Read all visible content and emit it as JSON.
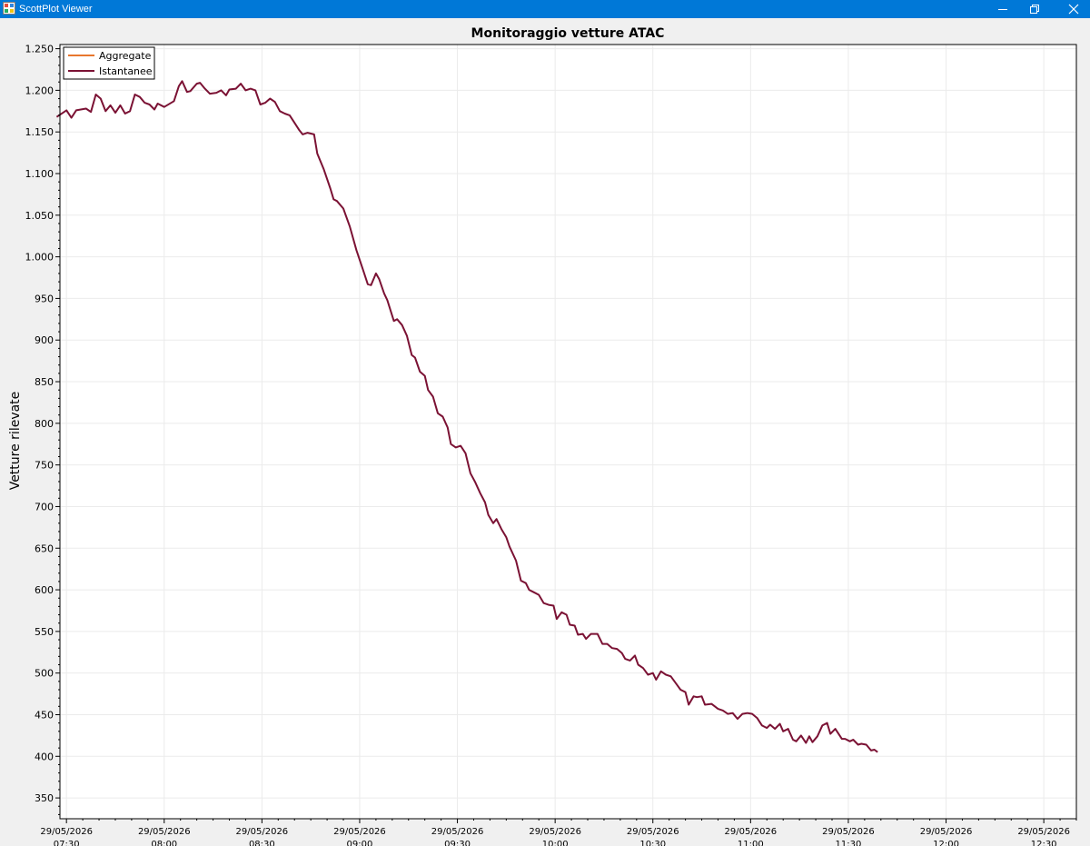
{
  "window": {
    "title": "ScottPlot Viewer"
  },
  "chart_data": {
    "type": "line",
    "title": "Monitoraggio vetture ATAC",
    "xlabel": "",
    "ylabel": "Vetture rilevate",
    "x_axis_type": "time",
    "xlim": [
      "2026-05-29T07:28",
      "2026-05-29T12:40"
    ],
    "ylim": [
      325,
      1255
    ],
    "grid": true,
    "legend_position": "top-left",
    "y_ticks": [
      {
        "value": 350,
        "label": "350"
      },
      {
        "value": 400,
        "label": "400"
      },
      {
        "value": 450,
        "label": "450"
      },
      {
        "value": 500,
        "label": "500"
      },
      {
        "value": 550,
        "label": "550"
      },
      {
        "value": 600,
        "label": "600"
      },
      {
        "value": 650,
        "label": "650"
      },
      {
        "value": 700,
        "label": "700"
      },
      {
        "value": 750,
        "label": "750"
      },
      {
        "value": 800,
        "label": "800"
      },
      {
        "value": 850,
        "label": "850"
      },
      {
        "value": 900,
        "label": "900"
      },
      {
        "value": 950,
        "label": "950"
      },
      {
        "value": 1000,
        "label": "1.000"
      },
      {
        "value": 1050,
        "label": "1.050"
      },
      {
        "value": 1100,
        "label": "1.100"
      },
      {
        "value": 1150,
        "label": "1.150"
      },
      {
        "value": 1200,
        "label": "1.200"
      },
      {
        "value": 1250,
        "label": "1.250"
      }
    ],
    "x_ticks": [
      {
        "value": "2026-05-29T07:30",
        "date": "29/05/2026",
        "time": "07:30"
      },
      {
        "value": "2026-05-29T08:00",
        "date": "29/05/2026",
        "time": "08:00"
      },
      {
        "value": "2026-05-29T08:30",
        "date": "29/05/2026",
        "time": "08:30"
      },
      {
        "value": "2026-05-29T09:00",
        "date": "29/05/2026",
        "time": "09:00"
      },
      {
        "value": "2026-05-29T09:30",
        "date": "29/05/2026",
        "time": "09:30"
      },
      {
        "value": "2026-05-29T10:00",
        "date": "29/05/2026",
        "time": "10:00"
      },
      {
        "value": "2026-05-29T10:30",
        "date": "29/05/2026",
        "time": "10:30"
      },
      {
        "value": "2026-05-29T11:00",
        "date": "29/05/2026",
        "time": "11:00"
      },
      {
        "value": "2026-05-29T11:30",
        "date": "29/05/2026",
        "time": "11:30"
      },
      {
        "value": "2026-05-29T12:00",
        "date": "29/05/2026",
        "time": "12:00"
      },
      {
        "value": "2026-05-29T12:30",
        "date": "29/05/2026",
        "time": "12:30"
      }
    ],
    "series": [
      {
        "name": "Aggregate",
        "color": "#e8772e",
        "points": []
      },
      {
        "name": "Istantanee",
        "color": "#7b1234",
        "points": [
          [
            "2026-05-29T07:27:00",
            1168
          ],
          [
            "2026-05-29T07:30:00",
            1176
          ],
          [
            "2026-05-29T07:31:30",
            1167
          ],
          [
            "2026-05-29T07:33:00",
            1176
          ],
          [
            "2026-05-29T07:36:00",
            1178
          ],
          [
            "2026-05-29T07:37:30",
            1174
          ],
          [
            "2026-05-29T07:39:00",
            1195
          ],
          [
            "2026-05-29T07:40:30",
            1190
          ],
          [
            "2026-05-29T07:42:00",
            1175
          ],
          [
            "2026-05-29T07:43:30",
            1182
          ],
          [
            "2026-05-29T07:45:00",
            1173
          ],
          [
            "2026-05-29T07:46:30",
            1182
          ],
          [
            "2026-05-29T07:48:00",
            1172
          ],
          [
            "2026-05-29T07:49:30",
            1175
          ],
          [
            "2026-05-29T07:51:00",
            1195
          ],
          [
            "2026-05-29T07:52:30",
            1192
          ],
          [
            "2026-05-29T07:54:00",
            1185
          ],
          [
            "2026-05-29T07:55:30",
            1183
          ],
          [
            "2026-05-29T07:57:00",
            1177
          ],
          [
            "2026-05-29T07:58:00",
            1184
          ],
          [
            "2026-05-29T08:00:00",
            1180
          ],
          [
            "2026-05-29T08:03:00",
            1187
          ],
          [
            "2026-05-29T08:04:30",
            1205
          ],
          [
            "2026-05-29T08:05:30",
            1211
          ],
          [
            "2026-05-29T08:07:00",
            1198
          ],
          [
            "2026-05-29T08:08:00",
            1199
          ],
          [
            "2026-05-29T08:10:00",
            1208
          ],
          [
            "2026-05-29T08:11:00",
            1209
          ],
          [
            "2026-05-29T08:12:30",
            1202
          ],
          [
            "2026-05-29T08:14:00",
            1196
          ],
          [
            "2026-05-29T08:16:00",
            1197
          ],
          [
            "2026-05-29T08:17:30",
            1200
          ],
          [
            "2026-05-29T08:19:00",
            1194
          ],
          [
            "2026-05-29T08:20:00",
            1201
          ],
          [
            "2026-05-29T08:22:00",
            1202
          ],
          [
            "2026-05-29T08:23:30",
            1208
          ],
          [
            "2026-05-29T08:25:00",
            1200
          ],
          [
            "2026-05-29T08:26:30",
            1202
          ],
          [
            "2026-05-29T08:28:00",
            1200
          ],
          [
            "2026-05-29T08:29:30",
            1183
          ],
          [
            "2026-05-29T08:31:00",
            1185
          ],
          [
            "2026-05-29T08:32:30",
            1190
          ],
          [
            "2026-05-29T08:34:00",
            1186
          ],
          [
            "2026-05-29T08:35:30",
            1175
          ],
          [
            "2026-05-29T08:37:00",
            1172
          ],
          [
            "2026-05-29T08:38:30",
            1170
          ],
          [
            "2026-05-29T08:40:00",
            1161
          ],
          [
            "2026-05-29T08:41:30",
            1152
          ],
          [
            "2026-05-29T08:42:30",
            1147
          ],
          [
            "2026-05-29T08:44:00",
            1149
          ],
          [
            "2026-05-29T08:46:00",
            1147
          ],
          [
            "2026-05-29T08:47:00",
            1124
          ],
          [
            "2026-05-29T08:49:00",
            1105
          ],
          [
            "2026-05-29T08:51:00",
            1082
          ],
          [
            "2026-05-29T08:52:00",
            1069
          ],
          [
            "2026-05-29T08:53:00",
            1067
          ],
          [
            "2026-05-29T08:55:00",
            1058
          ],
          [
            "2026-05-29T08:57:00",
            1036
          ],
          [
            "2026-05-29T08:59:00",
            1008
          ],
          [
            "2026-05-29T09:01:00",
            985
          ],
          [
            "2026-05-29T09:02:30",
            967
          ],
          [
            "2026-05-29T09:03:30",
            966
          ],
          [
            "2026-05-29T09:05:00",
            980
          ],
          [
            "2026-05-29T09:06:00",
            973
          ],
          [
            "2026-05-29T09:07:30",
            956
          ],
          [
            "2026-05-29T09:08:30",
            948
          ],
          [
            "2026-05-29T09:10:30",
            923
          ],
          [
            "2026-05-29T09:11:30",
            925
          ],
          [
            "2026-05-29T09:13:00",
            918
          ],
          [
            "2026-05-29T09:14:30",
            905
          ],
          [
            "2026-05-29T09:16:00",
            882
          ],
          [
            "2026-05-29T09:17:00",
            879
          ],
          [
            "2026-05-29T09:18:30",
            862
          ],
          [
            "2026-05-29T09:20:00",
            857
          ],
          [
            "2026-05-29T09:21:00",
            840
          ],
          [
            "2026-05-29T09:22:30",
            832
          ],
          [
            "2026-05-29T09:24:00",
            812
          ],
          [
            "2026-05-29T09:25:30",
            808
          ],
          [
            "2026-05-29T09:27:00",
            795
          ],
          [
            "2026-05-29T09:28:00",
            775
          ],
          [
            "2026-05-29T09:29:30",
            771
          ],
          [
            "2026-05-29T09:31:00",
            773
          ],
          [
            "2026-05-29T09:32:30",
            764
          ],
          [
            "2026-05-29T09:34:00",
            740
          ],
          [
            "2026-05-29T09:35:30",
            729
          ],
          [
            "2026-05-29T09:37:00",
            716
          ],
          [
            "2026-05-29T09:38:30",
            705
          ],
          [
            "2026-05-29T09:39:30",
            690
          ],
          [
            "2026-05-29T09:41:00",
            680
          ],
          [
            "2026-05-29T09:42:00",
            685
          ],
          [
            "2026-05-29T09:43:30",
            673
          ],
          [
            "2026-05-29T09:45:00",
            663
          ],
          [
            "2026-05-29T09:46:00",
            652
          ],
          [
            "2026-05-29T09:48:00",
            635
          ],
          [
            "2026-05-29T09:49:30",
            611
          ],
          [
            "2026-05-29T09:51:00",
            608
          ],
          [
            "2026-05-29T09:52:00",
            600
          ],
          [
            "2026-05-29T09:53:30",
            597
          ],
          [
            "2026-05-29T09:55:00",
            594
          ],
          [
            "2026-05-29T09:56:30",
            584
          ],
          [
            "2026-05-29T09:58:00",
            582
          ],
          [
            "2026-05-29T09:59:30",
            581
          ],
          [
            "2026-05-29T10:00:30",
            565
          ],
          [
            "2026-05-29T10:02:00",
            573
          ],
          [
            "2026-05-29T10:03:30",
            570
          ],
          [
            "2026-05-29T10:04:30",
            558
          ],
          [
            "2026-05-29T10:06:00",
            557
          ],
          [
            "2026-05-29T10:07:00",
            546
          ],
          [
            "2026-05-29T10:08:30",
            547
          ],
          [
            "2026-05-29T10:09:30",
            541
          ],
          [
            "2026-05-29T10:11:00",
            547
          ],
          [
            "2026-05-29T10:13:00",
            547
          ],
          [
            "2026-05-29T10:14:30",
            535
          ],
          [
            "2026-05-29T10:16:00",
            535
          ],
          [
            "2026-05-29T10:17:30",
            530
          ],
          [
            "2026-05-29T10:19:00",
            529
          ],
          [
            "2026-05-29T10:20:30",
            524
          ],
          [
            "2026-05-29T10:21:30",
            517
          ],
          [
            "2026-05-29T10:23:00",
            515
          ],
          [
            "2026-05-29T10:24:30",
            521
          ],
          [
            "2026-05-29T10:25:30",
            510
          ],
          [
            "2026-05-29T10:27:00",
            506
          ],
          [
            "2026-05-29T10:28:30",
            498
          ],
          [
            "2026-05-29T10:30:00",
            500
          ],
          [
            "2026-05-29T10:31:00",
            492
          ],
          [
            "2026-05-29T10:32:30",
            502
          ],
          [
            "2026-05-29T10:34:00",
            498
          ],
          [
            "2026-05-29T10:35:30",
            496
          ],
          [
            "2026-05-29T10:37:00",
            488
          ],
          [
            "2026-05-29T10:38:30",
            480
          ],
          [
            "2026-05-29T10:40:00",
            477
          ],
          [
            "2026-05-29T10:41:00",
            462
          ],
          [
            "2026-05-29T10:42:30",
            472
          ],
          [
            "2026-05-29T10:43:30",
            471
          ],
          [
            "2026-05-29T10:45:00",
            472
          ],
          [
            "2026-05-29T10:46:00",
            462
          ],
          [
            "2026-05-29T10:48:00",
            463
          ],
          [
            "2026-05-29T10:50:00",
            457
          ],
          [
            "2026-05-29T10:51:30",
            455
          ],
          [
            "2026-05-29T10:53:00",
            451
          ],
          [
            "2026-05-29T10:54:30",
            452
          ],
          [
            "2026-05-29T10:56:00",
            445
          ],
          [
            "2026-05-29T10:57:30",
            451
          ],
          [
            "2026-05-29T10:59:00",
            452
          ],
          [
            "2026-05-29T11:00:30",
            451
          ],
          [
            "2026-05-29T11:02:00",
            446
          ],
          [
            "2026-05-29T11:03:30",
            437
          ],
          [
            "2026-05-29T11:05:00",
            434
          ],
          [
            "2026-05-29T11:06:00",
            438
          ],
          [
            "2026-05-29T11:07:30",
            433
          ],
          [
            "2026-05-29T11:09:00",
            439
          ],
          [
            "2026-05-29T11:10:00",
            430
          ],
          [
            "2026-05-29T11:11:30",
            433
          ],
          [
            "2026-05-29T11:13:00",
            420
          ],
          [
            "2026-05-29T11:14:00",
            418
          ],
          [
            "2026-05-29T11:15:30",
            425
          ],
          [
            "2026-05-29T11:17:00",
            416
          ],
          [
            "2026-05-29T11:18:00",
            424
          ],
          [
            "2026-05-29T11:19:00",
            417
          ],
          [
            "2026-05-29T11:20:30",
            424
          ],
          [
            "2026-05-29T11:22:00",
            437
          ],
          [
            "2026-05-29T11:23:30",
            440
          ],
          [
            "2026-05-29T11:24:30",
            427
          ],
          [
            "2026-05-29T11:26:00",
            433
          ],
          [
            "2026-05-29T11:28:00",
            421
          ],
          [
            "2026-05-29T11:29:00",
            421
          ],
          [
            "2026-05-29T11:30:30",
            418
          ],
          [
            "2026-05-29T11:31:30",
            420
          ],
          [
            "2026-05-29T11:33:00",
            414
          ],
          [
            "2026-05-29T11:34:00",
            415
          ],
          [
            "2026-05-29T11:35:30",
            414
          ],
          [
            "2026-05-29T11:37:00",
            407
          ],
          [
            "2026-05-29T11:38:00",
            408
          ],
          [
            "2026-05-29T11:39:00",
            405
          ]
        ]
      }
    ]
  }
}
